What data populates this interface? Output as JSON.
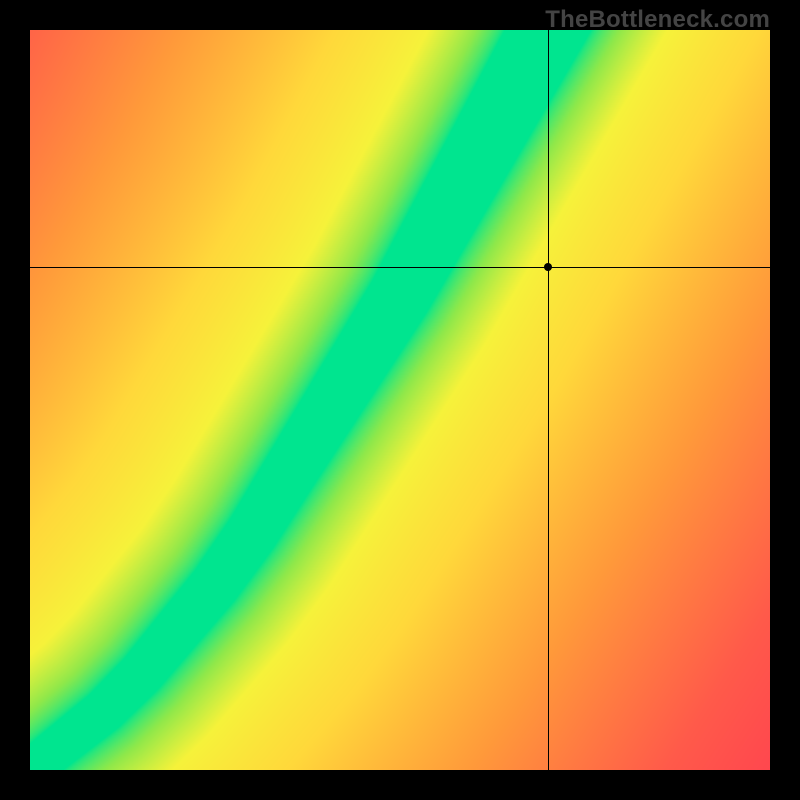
{
  "watermark": "TheBottleneck.com",
  "chart_data": {
    "type": "heatmap",
    "title": "",
    "xlabel": "",
    "ylabel": "",
    "xlim": [
      0,
      1
    ],
    "ylim": [
      0,
      1
    ],
    "grid": false,
    "legend": false,
    "marker": {
      "x": 0.7,
      "y": 0.68
    },
    "crosshair": {
      "x": 0.7,
      "y": 0.68
    },
    "optimal_curve": {
      "description": "Green ridge of optimal pairing; value is distance-based gradient from this curve",
      "points": [
        {
          "x": 0.0,
          "y": 0.0
        },
        {
          "x": 0.05,
          "y": 0.04
        },
        {
          "x": 0.1,
          "y": 0.08
        },
        {
          "x": 0.15,
          "y": 0.13
        },
        {
          "x": 0.2,
          "y": 0.19
        },
        {
          "x": 0.25,
          "y": 0.25
        },
        {
          "x": 0.3,
          "y": 0.32
        },
        {
          "x": 0.35,
          "y": 0.4
        },
        {
          "x": 0.4,
          "y": 0.48
        },
        {
          "x": 0.45,
          "y": 0.56
        },
        {
          "x": 0.5,
          "y": 0.64
        },
        {
          "x": 0.55,
          "y": 0.73
        },
        {
          "x": 0.6,
          "y": 0.82
        },
        {
          "x": 0.65,
          "y": 0.91
        },
        {
          "x": 0.7,
          "y": 1.0
        }
      ]
    },
    "colormap": {
      "stops": [
        {
          "t": 0.0,
          "color": "#00e58f"
        },
        {
          "t": 0.1,
          "color": "#8fe84a"
        },
        {
          "t": 0.2,
          "color": "#f6f23a"
        },
        {
          "t": 0.35,
          "color": "#ffd83a"
        },
        {
          "t": 0.55,
          "color": "#ff9a3a"
        },
        {
          "t": 0.75,
          "color": "#ff5a4a"
        },
        {
          "t": 1.0,
          "color": "#ff2a55"
        }
      ]
    },
    "ridge_width": 0.045,
    "ridge_width_growth": 0.9
  }
}
